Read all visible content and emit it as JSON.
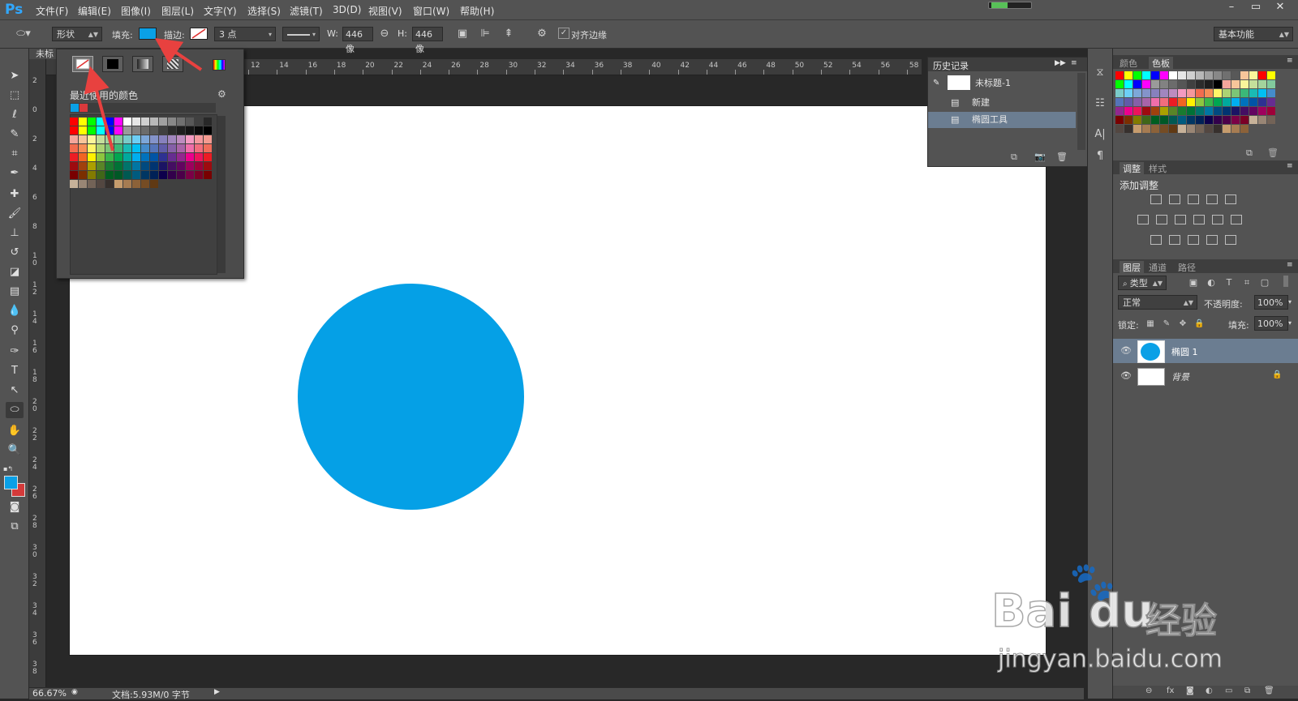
{
  "app": {
    "logo": "Ps"
  },
  "menu": [
    "文件(F)",
    "编辑(E)",
    "图像(I)",
    "图层(L)",
    "文字(Y)",
    "选择(S)",
    "滤镜(T)",
    "3D(D)",
    "视图(V)",
    "窗口(W)",
    "帮助(H)"
  ],
  "window_controls": [
    "–",
    "▭",
    "✕"
  ],
  "options": {
    "mode": "形状",
    "fill_label": "填充:",
    "stroke_label": "描边:",
    "stroke_width": "3 点",
    "w_label": "W:",
    "w_value": "446 像",
    "h_label": "H:",
    "h_value": "446 像",
    "align_edges": "对齐边缘",
    "workspace": "基本功能",
    "fill_color": "#0aa0e6"
  },
  "document": {
    "tab": "未标"
  },
  "fill_popup": {
    "recent_label": "最近使用的颜色",
    "recent_colors": [
      "#0aa0e6",
      "#d9393c"
    ]
  },
  "ruler_top": [
    "12",
    "14",
    "16",
    "18",
    "20",
    "22",
    "24",
    "26",
    "28",
    "30",
    "32",
    "34",
    "36",
    "38",
    "40",
    "42",
    "44",
    "46",
    "48",
    "50",
    "52",
    "54",
    "56",
    "58"
  ],
  "ruler_left": [
    "2",
    "0",
    "2",
    "4",
    "6",
    "8",
    "1 0",
    "1 2",
    "1 4",
    "1 6",
    "1 8",
    "2 0",
    "2 2",
    "2 4",
    "2 6",
    "2 8",
    "3 0",
    "3 2",
    "3 4",
    "3 6",
    "3 8"
  ],
  "status": {
    "zoom": "66.67%",
    "doc": "文档:5.93M/0 字节"
  },
  "history": {
    "tab": "历史记录",
    "snapshot": "未标题-1",
    "items": [
      "新建",
      "椭圆工具"
    ]
  },
  "color_panel": {
    "tabs": [
      "颜色",
      "色板"
    ]
  },
  "adjustments": {
    "tabs": [
      "调整",
      "样式"
    ],
    "add_label": "添加调整"
  },
  "layers": {
    "tabs": [
      "图层",
      "通道",
      "路径"
    ],
    "filter_kind": "类型",
    "blend_mode": "正常",
    "opacity_label": "不透明度:",
    "opacity": "100%",
    "lock_label": "锁定:",
    "fill_label": "填充:",
    "fill": "100%",
    "items": [
      {
        "name": "椭圆 1",
        "selected": true
      },
      {
        "name": "背景",
        "selected": false
      }
    ]
  },
  "watermark": {
    "brand": "Bai",
    "brand2": "du",
    "cn": "经验",
    "url": "jingyan.baidu.com"
  }
}
